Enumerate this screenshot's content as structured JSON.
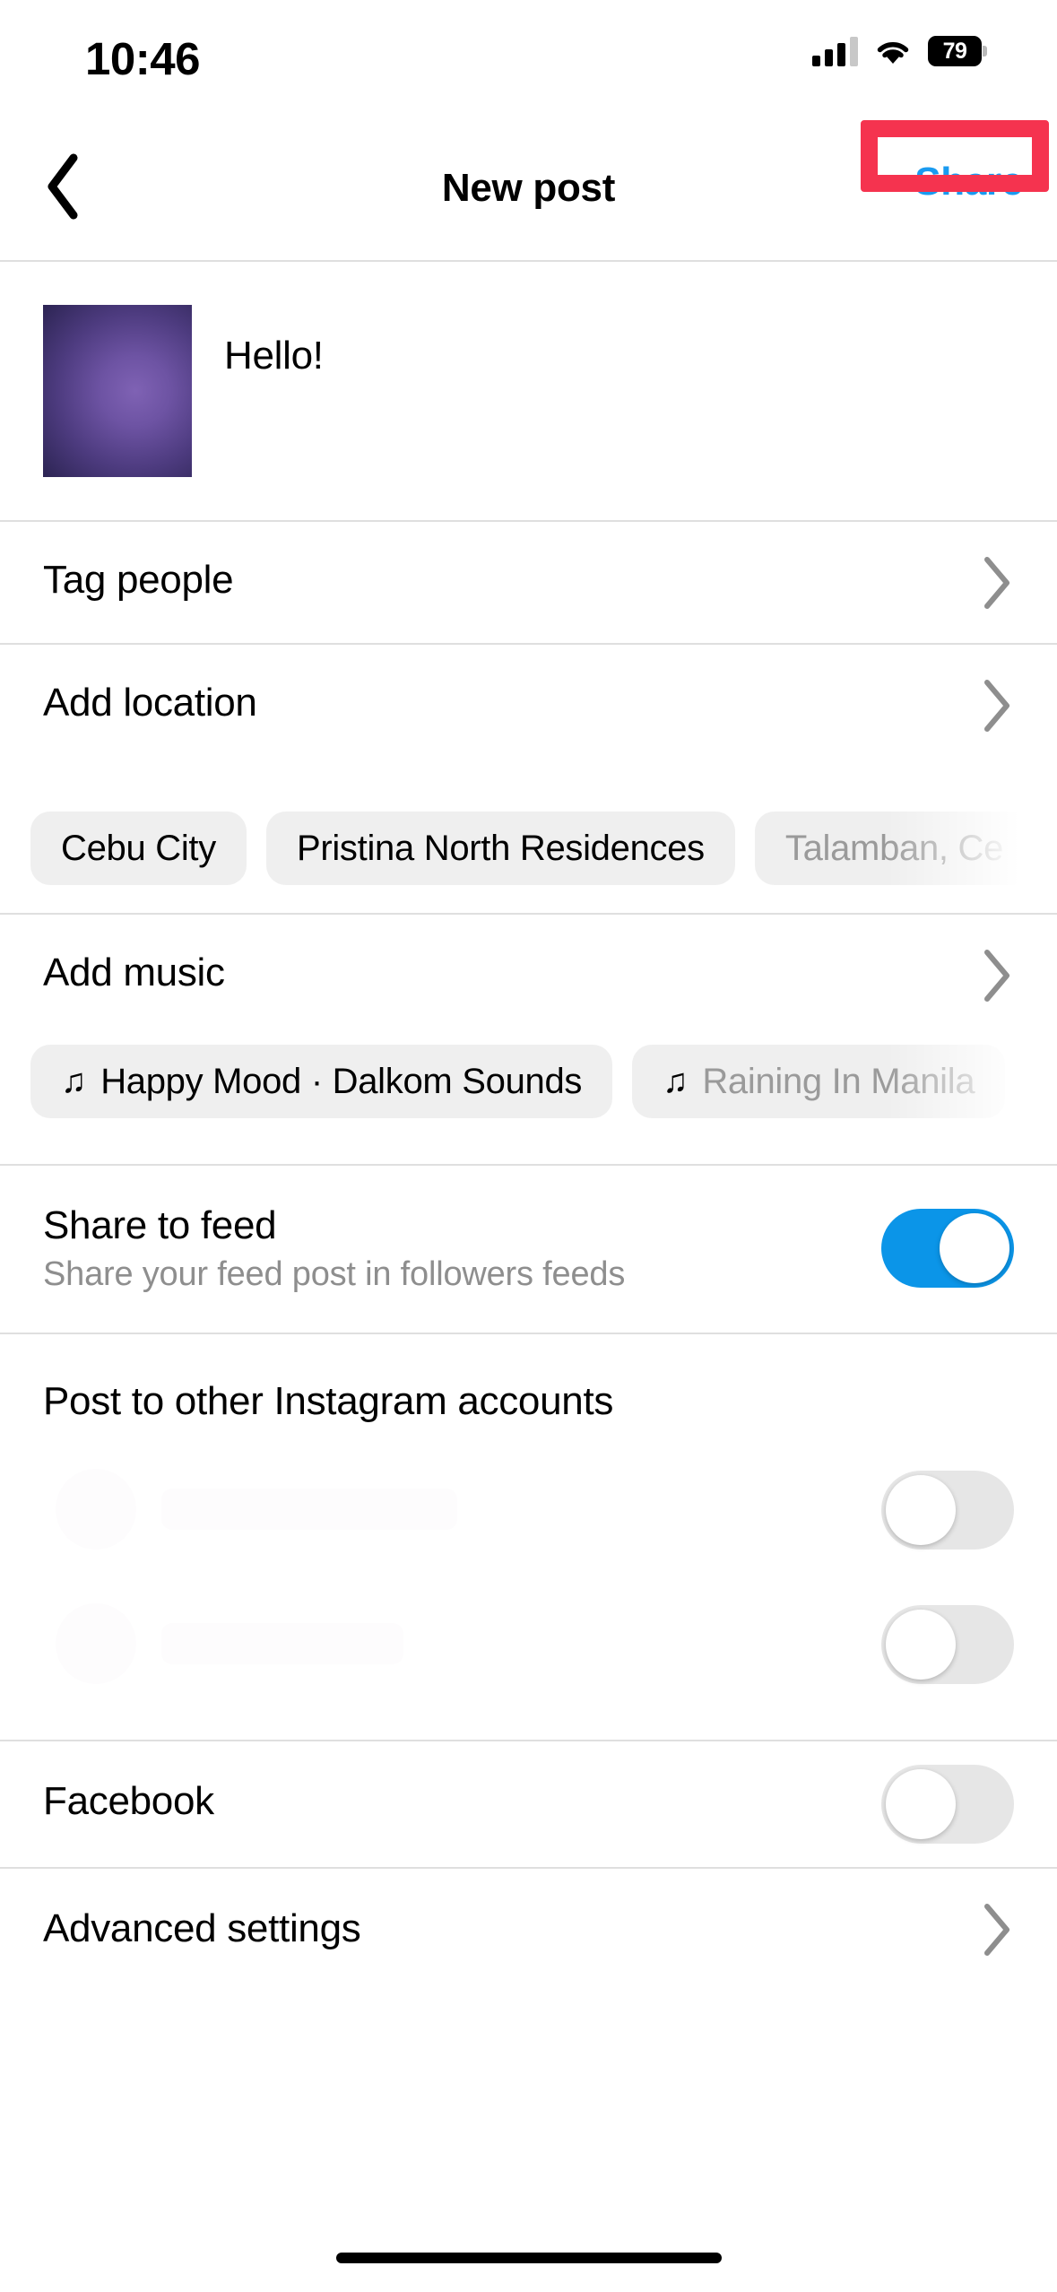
{
  "status_bar": {
    "time": "10:46",
    "battery_percent": "79",
    "signal_icon": "cellular-signal-icon",
    "wifi_icon": "wifi-icon",
    "battery_icon": "battery-icon"
  },
  "nav": {
    "back_icon": "chevron-left-icon",
    "title": "New post",
    "share_label": "Share",
    "share_color": "#1a9bf0",
    "highlight_color": "#f5334f"
  },
  "caption": {
    "text": "Hello!",
    "thumbnail_name": "post-thumbnail"
  },
  "rows": {
    "tag_people": {
      "label": "Tag people",
      "chevron": "chevron-right-icon"
    },
    "add_location": {
      "label": "Add location",
      "chevron": "chevron-right-icon"
    },
    "add_music": {
      "label": "Add music",
      "chevron": "chevron-right-icon"
    },
    "advanced_settings": {
      "label": "Advanced settings",
      "chevron": "chevron-right-icon"
    }
  },
  "location_suggestions": [
    {
      "label": "Cebu City",
      "faded": false
    },
    {
      "label": "Pristina North Residences",
      "faded": false
    },
    {
      "label": "Talamban, Ce",
      "faded": true
    }
  ],
  "music_suggestions": [
    {
      "icon": "music-note-icon",
      "label": "Happy Mood · Dalkom Sounds",
      "faded": false
    },
    {
      "icon": "music-note-icon",
      "label": "Raining In Manila",
      "faded": true
    }
  ],
  "share_to_feed": {
    "title": "Share to feed",
    "subtitle": "Share your feed post in followers feeds",
    "toggle_state": "on",
    "toggle_on_color": "#0b95e8"
  },
  "other_accounts": {
    "title": "Post to other Instagram accounts",
    "toggles": [
      {
        "state": "off"
      },
      {
        "state": "off"
      }
    ]
  },
  "facebook": {
    "label": "Facebook",
    "toggle_state": "off"
  }
}
